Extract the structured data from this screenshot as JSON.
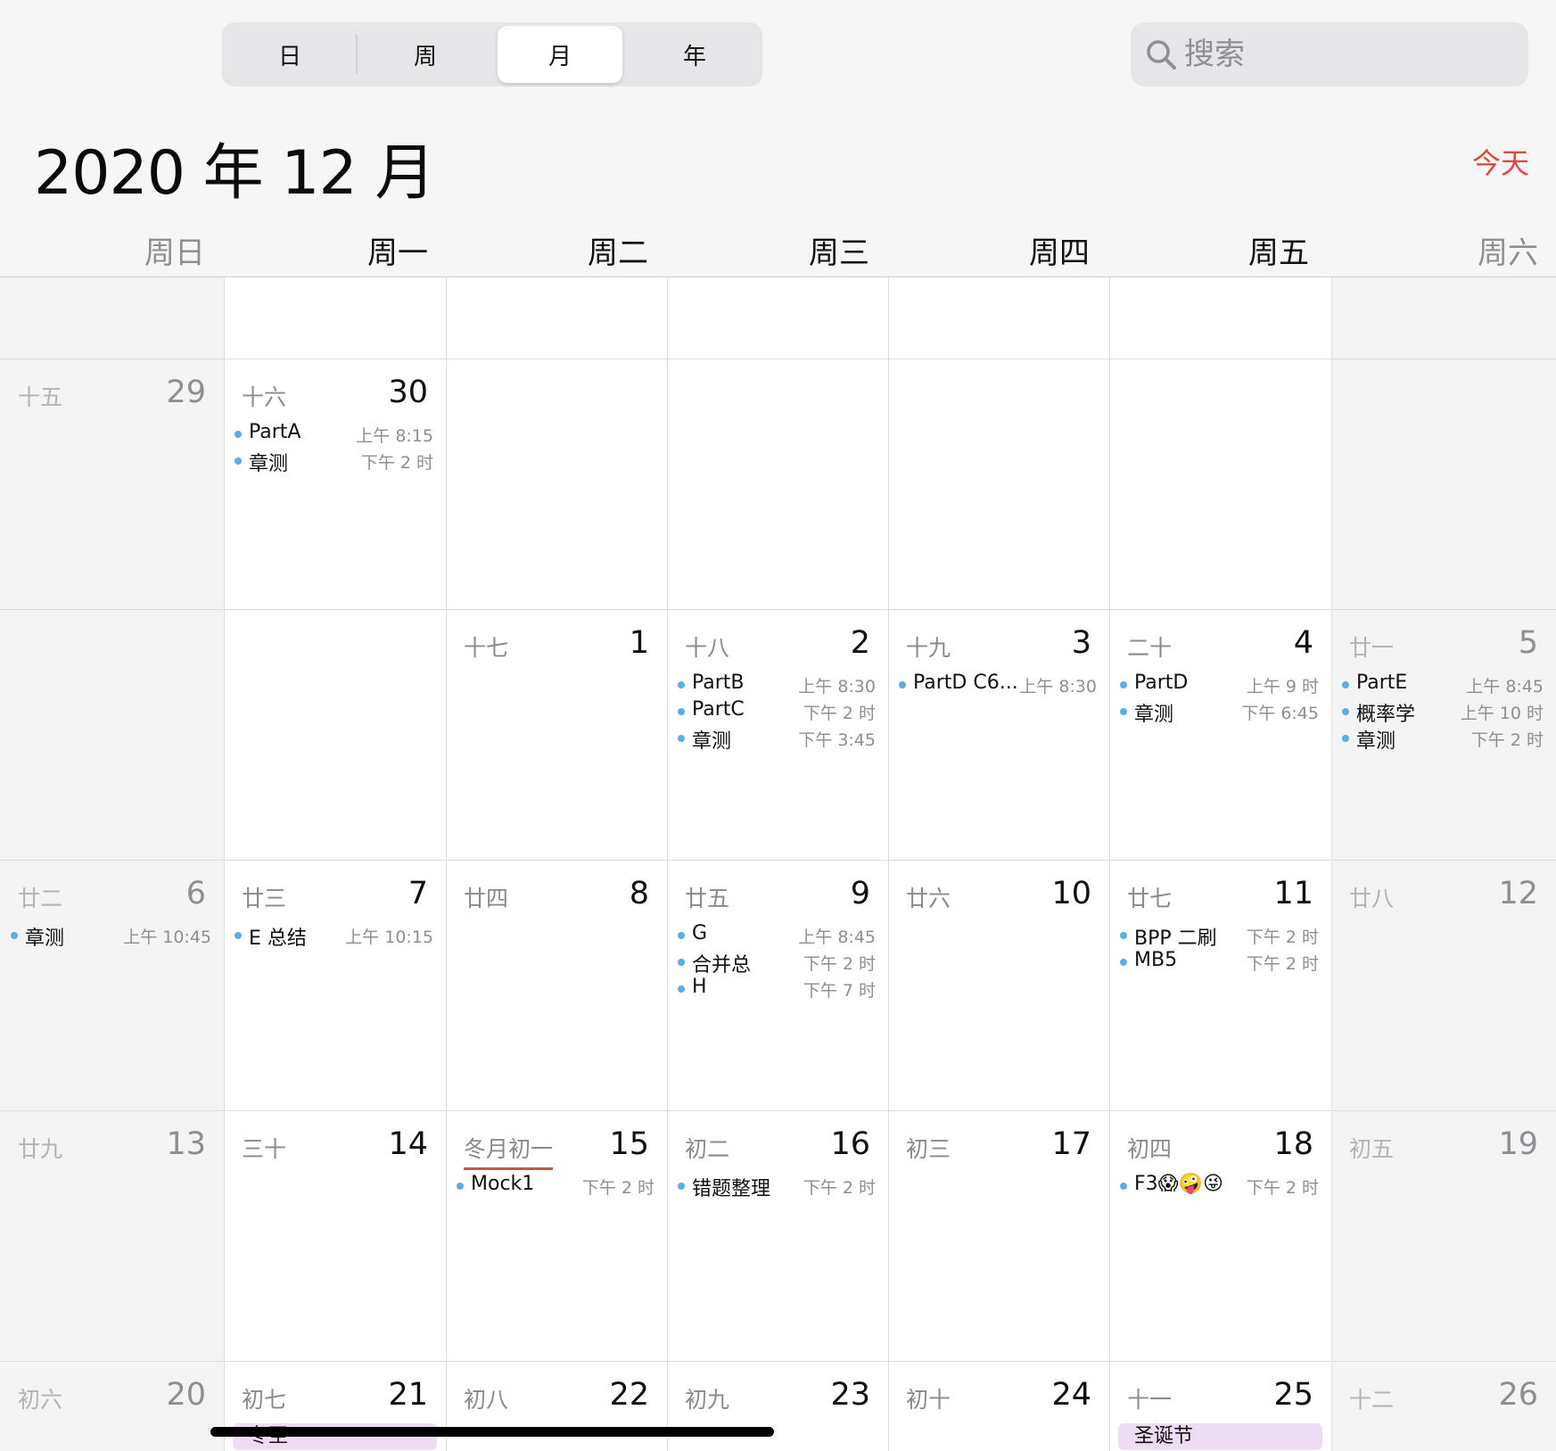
{
  "view_switcher": {
    "day": "日",
    "week": "周",
    "month": "月",
    "year": "年",
    "selected": "月"
  },
  "search": {
    "placeholder": "搜索",
    "icon": "search-icon"
  },
  "header": {
    "title": "2020 年 12 月",
    "today": "今天"
  },
  "colors": {
    "accent": "#e0493e",
    "event_dot": "#5aaee8",
    "allday_bg": "#eedcf2",
    "today_underline": "#c9554c"
  },
  "weekdays": [
    "周日",
    "周一",
    "周二",
    "周三",
    "周四",
    "周五",
    "周六"
  ],
  "weeks": [
    {
      "days": [
        {
          "lunar": "十五",
          "num": "29",
          "events": []
        },
        {
          "lunar": "十六",
          "num": "30",
          "events": [
            {
              "title": "PartA",
              "time": "上午 8:15"
            },
            {
              "title": "章测",
              "time": "下午 2 时"
            }
          ]
        },
        null,
        null,
        null,
        null,
        null
      ]
    },
    {
      "days": [
        null,
        null,
        {
          "lunar": "十七",
          "num": "1",
          "events": []
        },
        {
          "lunar": "十八",
          "num": "2",
          "events": [
            {
              "title": "PartB",
              "time": "上午 8:30"
            },
            {
              "title": "PartC",
              "time": "下午 2 时"
            },
            {
              "title": "章测",
              "time": "下午 3:45"
            }
          ]
        },
        {
          "lunar": "十九",
          "num": "3",
          "events": [
            {
              "title": "PartD C6...",
              "time": "上午 8:30"
            }
          ]
        },
        {
          "lunar": "二十",
          "num": "4",
          "events": [
            {
              "title": "PartD",
              "time": "上午 9 时"
            },
            {
              "title": "章测",
              "time": "下午 6:45"
            }
          ]
        },
        {
          "lunar": "廿一",
          "num": "5",
          "events": [
            {
              "title": "PartE",
              "time": "上午 8:45"
            },
            {
              "title": "概率学",
              "time": "上午 10 时"
            },
            {
              "title": "章测",
              "time": "下午 2 时"
            }
          ]
        }
      ]
    },
    {
      "days": [
        {
          "lunar": "廿二",
          "num": "6",
          "events": [
            {
              "title": "章测",
              "time": "上午 10:45"
            }
          ]
        },
        {
          "lunar": "廿三",
          "num": "7",
          "events": [
            {
              "title": "E 总结",
              "time": "上午 10:15"
            }
          ]
        },
        {
          "lunar": "廿四",
          "num": "8",
          "events": []
        },
        {
          "lunar": "廿五",
          "num": "9",
          "events": [
            {
              "title": "G",
              "time": "上午 8:45"
            },
            {
              "title": "合并总",
              "time": "下午 2 时"
            },
            {
              "title": "H",
              "time": "下午 7 时"
            }
          ]
        },
        {
          "lunar": "廿六",
          "num": "10",
          "events": []
        },
        {
          "lunar": "廿七",
          "num": "11",
          "events": [
            {
              "title": "BPP 二刷",
              "time": "下午 2 时"
            },
            {
              "title": "MB5",
              "time": "下午 2 时"
            }
          ]
        },
        {
          "lunar": "廿八",
          "num": "12",
          "events": []
        }
      ]
    },
    {
      "days": [
        {
          "lunar": "廿九",
          "num": "13",
          "events": []
        },
        {
          "lunar": "三十",
          "num": "14",
          "events": []
        },
        {
          "lunar": "冬月初一",
          "num": "15",
          "events": [
            {
              "title": "Mock1",
              "time": "下午 2 时"
            }
          ]
        },
        {
          "lunar": "初二",
          "num": "16",
          "events": [
            {
              "title": "错题整理",
              "time": "下午 2 时"
            }
          ]
        },
        {
          "lunar": "初三",
          "num": "17",
          "events": []
        },
        {
          "lunar": "初四",
          "num": "18",
          "events": [
            {
              "title": "F3😱🤪😜",
              "time": "下午 2 时"
            }
          ]
        },
        {
          "lunar": "初五",
          "num": "19",
          "events": []
        }
      ]
    },
    {
      "days": [
        {
          "lunar": "初六",
          "num": "20",
          "events": []
        },
        {
          "lunar": "初七",
          "num": "21",
          "events": [],
          "allday": "冬至"
        },
        {
          "lunar": "初八",
          "num": "22",
          "events": []
        },
        {
          "lunar": "初九",
          "num": "23",
          "events": []
        },
        {
          "lunar": "初十",
          "num": "24",
          "events": []
        },
        {
          "lunar": "十一",
          "num": "25",
          "events": [],
          "allday": "圣诞节"
        },
        {
          "lunar": "十二",
          "num": "26",
          "events": []
        }
      ]
    }
  ]
}
